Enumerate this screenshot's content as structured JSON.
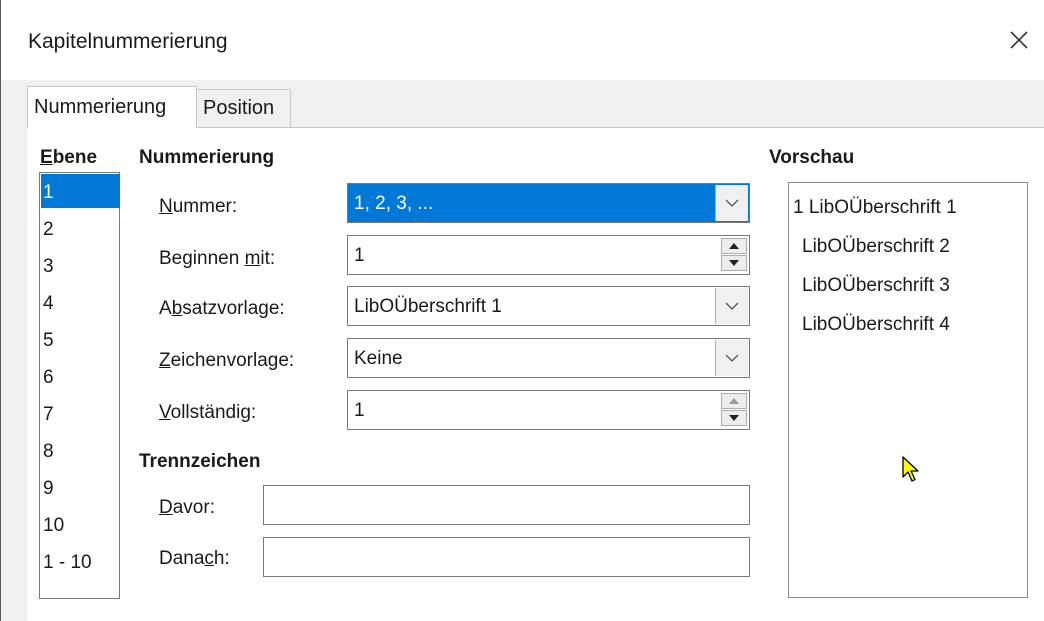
{
  "window": {
    "title": "Kapitelnummerierung"
  },
  "tabs": [
    {
      "label": "Nummerierung",
      "active": true
    },
    {
      "label": "Position",
      "active": false
    }
  ],
  "levels": {
    "heading_prefix": "E",
    "heading_rest": "bene",
    "items": [
      "1",
      "2",
      "3",
      "4",
      "5",
      "6",
      "7",
      "8",
      "9",
      "10",
      "1 - 10"
    ],
    "selected": "1"
  },
  "numbering": {
    "heading": "Nummerierung",
    "number": {
      "label_mn": "N",
      "label_rest": "ummer:",
      "value": "1, 2, 3, ..."
    },
    "start": {
      "label_pre": "Beginnen ",
      "label_mn": "m",
      "label_rest": "it:",
      "value": "1"
    },
    "paragraph_style": {
      "label_pre": "A",
      "label_mn": "b",
      "label_rest": "satzvorlage:",
      "value": "LibOÜberschrift 1"
    },
    "char_style": {
      "label_mn": "Z",
      "label_rest": "eichenvorlage:",
      "value": "Keine"
    },
    "complete": {
      "label_mn": "V",
      "label_rest": "ollständig:",
      "value": "1"
    }
  },
  "separator": {
    "heading": "Trennzeichen",
    "before": {
      "label_mn": "D",
      "label_rest": "avor:",
      "value": ""
    },
    "after": {
      "label_pre": "Dana",
      "label_mn": "c",
      "label_rest": "h:",
      "value": ""
    }
  },
  "preview": {
    "heading": "Vorschau",
    "lines": [
      "1 LibOÜberschrift 1",
      "LibOÜberschrift 2",
      "LibOÜberschrift 3",
      "LibOÜberschrift 4"
    ]
  },
  "colors": {
    "selection": "#0078d7",
    "cursor": "#ffff00"
  }
}
